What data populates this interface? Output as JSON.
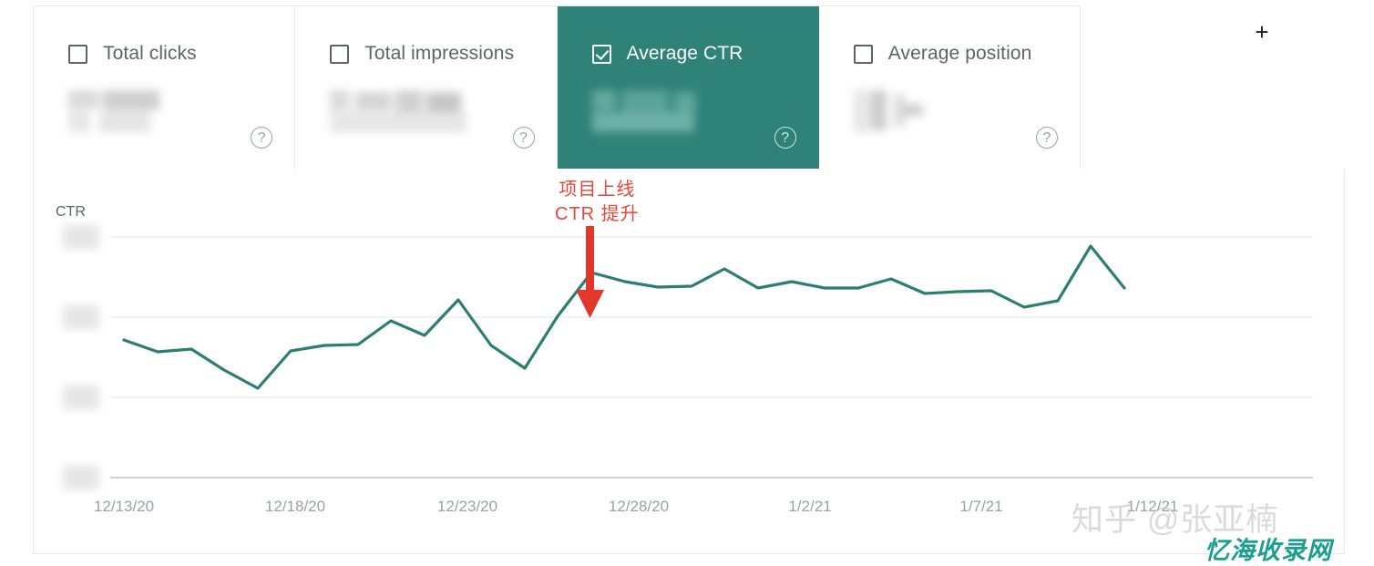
{
  "metric_cards": [
    {
      "label": "Total clicks",
      "selected": false,
      "checked": false,
      "value_redacted": true,
      "help_icon": "help-circle-icon"
    },
    {
      "label": "Total impressions",
      "selected": false,
      "checked": false,
      "value_redacted": true,
      "help_icon": "help-circle-icon"
    },
    {
      "label": "Average CTR",
      "selected": true,
      "checked": true,
      "value_redacted": true,
      "help_icon": "help-circle-icon"
    },
    {
      "label": "Average position",
      "selected": false,
      "checked": false,
      "value_redacted": true,
      "help_icon": "help-circle-icon"
    }
  ],
  "toolbar": {
    "add_metric_label": "+",
    "add_metric_icon": "plus-icon"
  },
  "annotation": {
    "line1": "项目上线",
    "line2": "CTR 提升",
    "color": "#e8463c",
    "marker": "down-arrow-icon"
  },
  "watermarks": {
    "zhihu": "知乎 @张亚楠",
    "site": "忆海收录网",
    "site_color": "#1b9e8f"
  },
  "colors": {
    "accent_teal": "#2e8277",
    "line_teal": "#2e7d73",
    "annotation_red": "#e8463c",
    "grid": "#eceff1",
    "axis": "#9aa0a6"
  },
  "chart_data": {
    "type": "line",
    "title": "",
    "xlabel": "",
    "ylabel": "CTR",
    "grid": true,
    "legend_position": "none",
    "y_tick_labels_redacted": true,
    "y_tick_count": 4,
    "x_tick_labels": [
      "12/13/20",
      "12/18/20",
      "12/23/20",
      "12/28/20",
      "1/2/21",
      "1/7/21",
      "1/12/21"
    ],
    "series": [
      {
        "name": "Average CTR",
        "color": "#2e7d73",
        "values": [
          0.455,
          0.42,
          0.428,
          0.357,
          0.3,
          0.42,
          0.437,
          0.44,
          0.512,
          0.468,
          0.545,
          0.39,
          0.33,
          0.5,
          0.61,
          0.585,
          0.568,
          0.57,
          0.62,
          0.56,
          0.578,
          0.56,
          0.56,
          0.588,
          0.548,
          0.552,
          0.555,
          0.5,
          0.52,
          0.72,
          0.592
        ]
      }
    ],
    "ylim": [
      0,
      1
    ],
    "annotation_point_index": 14,
    "annotation_text": "项目上线 / CTR 提升"
  }
}
